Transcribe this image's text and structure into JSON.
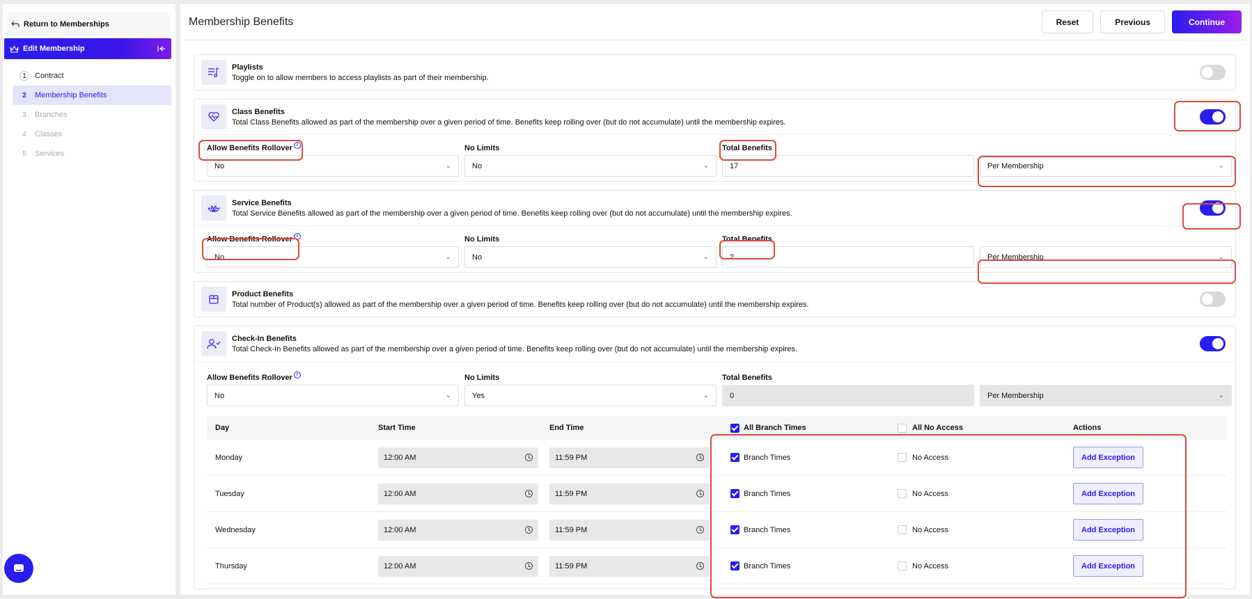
{
  "sidebar": {
    "return_label": "Return to Memberships",
    "edit_label": "Edit Membership",
    "steps": [
      {
        "num": "1",
        "label": "Contract"
      },
      {
        "num": "2",
        "label": "Membership Benefits"
      },
      {
        "num": "3",
        "label": "Branches"
      },
      {
        "num": "4",
        "label": "Classes"
      },
      {
        "num": "5",
        "label": "Services"
      }
    ]
  },
  "header": {
    "title": "Membership Benefits",
    "reset": "Reset",
    "previous": "Previous",
    "continue": "Continue"
  },
  "playlists": {
    "title": "Playlists",
    "desc": "Toggle on to allow members to access playlists as part of their membership.",
    "enabled": false
  },
  "class_benefits": {
    "title": "Class Benefits",
    "desc": "Total Class Benefits allowed as part of the membership over a given period of time. Benefits keep rolling over (but do not accumulate) until the membership expires.",
    "enabled": true,
    "rollover_label": "Allow Benefits Rollover",
    "rollover_value": "No",
    "nolimits_label": "No Limits",
    "nolimits_value": "No",
    "total_label": "Total Benefits",
    "total_value": "17",
    "period_value": "Per Membership"
  },
  "service_benefits": {
    "title": "Service Benefits",
    "desc": "Total Service Benefits allowed as part of the membership over a given period of time. Benefits keep rolling over (but do not accumulate) until the membership expires.",
    "enabled": true,
    "rollover_label": "Allow Benefits Rollover",
    "rollover_value": "No",
    "nolimits_label": "No Limits",
    "nolimits_value": "No",
    "total_label": "Total Benefits",
    "total_value": "2",
    "period_value": "Per Membership"
  },
  "product_benefits": {
    "title": "Product Benefits",
    "desc": "Total number of Product(s) allowed as part of the membership over a given period of time. Benefits keep rolling over (but do not accumulate) until the membership expires.",
    "enabled": false
  },
  "checkin_benefits": {
    "title": "Check-In Benefits",
    "desc": "Total Check-In Benefits allowed as part of the membership over a given period of time. Benefits keep rolling over (but do not accumulate) until the membership expires.",
    "enabled": true,
    "rollover_label": "Allow Benefits Rollover",
    "rollover_value": "No",
    "nolimits_label": "No Limits",
    "nolimits_value": "Yes",
    "total_label": "Total Benefits",
    "total_value": "0",
    "period_value": "Per Membership"
  },
  "schedule": {
    "headers": {
      "day": "Day",
      "start": "Start Time",
      "end": "End Time",
      "all_branch": "All Branch Times",
      "all_no_access": "All No Access",
      "actions": "Actions"
    },
    "rows": [
      {
        "day": "Monday",
        "start": "12:00 AM",
        "end": "11:59 PM",
        "branch": "Branch Times",
        "no_access": "No Access",
        "action": "Add Exception"
      },
      {
        "day": "Tuesday",
        "start": "12:00 AM",
        "end": "11:59 PM",
        "branch": "Branch Times",
        "no_access": "No Access",
        "action": "Add Exception"
      },
      {
        "day": "Wednesday",
        "start": "12:00 AM",
        "end": "11:59 PM",
        "branch": "Branch Times",
        "no_access": "No Access",
        "action": "Add Exception"
      },
      {
        "day": "Thursday",
        "start": "12:00 AM",
        "end": "11:59 PM",
        "branch": "Branch Times",
        "no_access": "No Access",
        "action": "Add Exception"
      }
    ]
  },
  "colors": {
    "accent": "#2a1df0",
    "highlight": "#d84b3a"
  }
}
